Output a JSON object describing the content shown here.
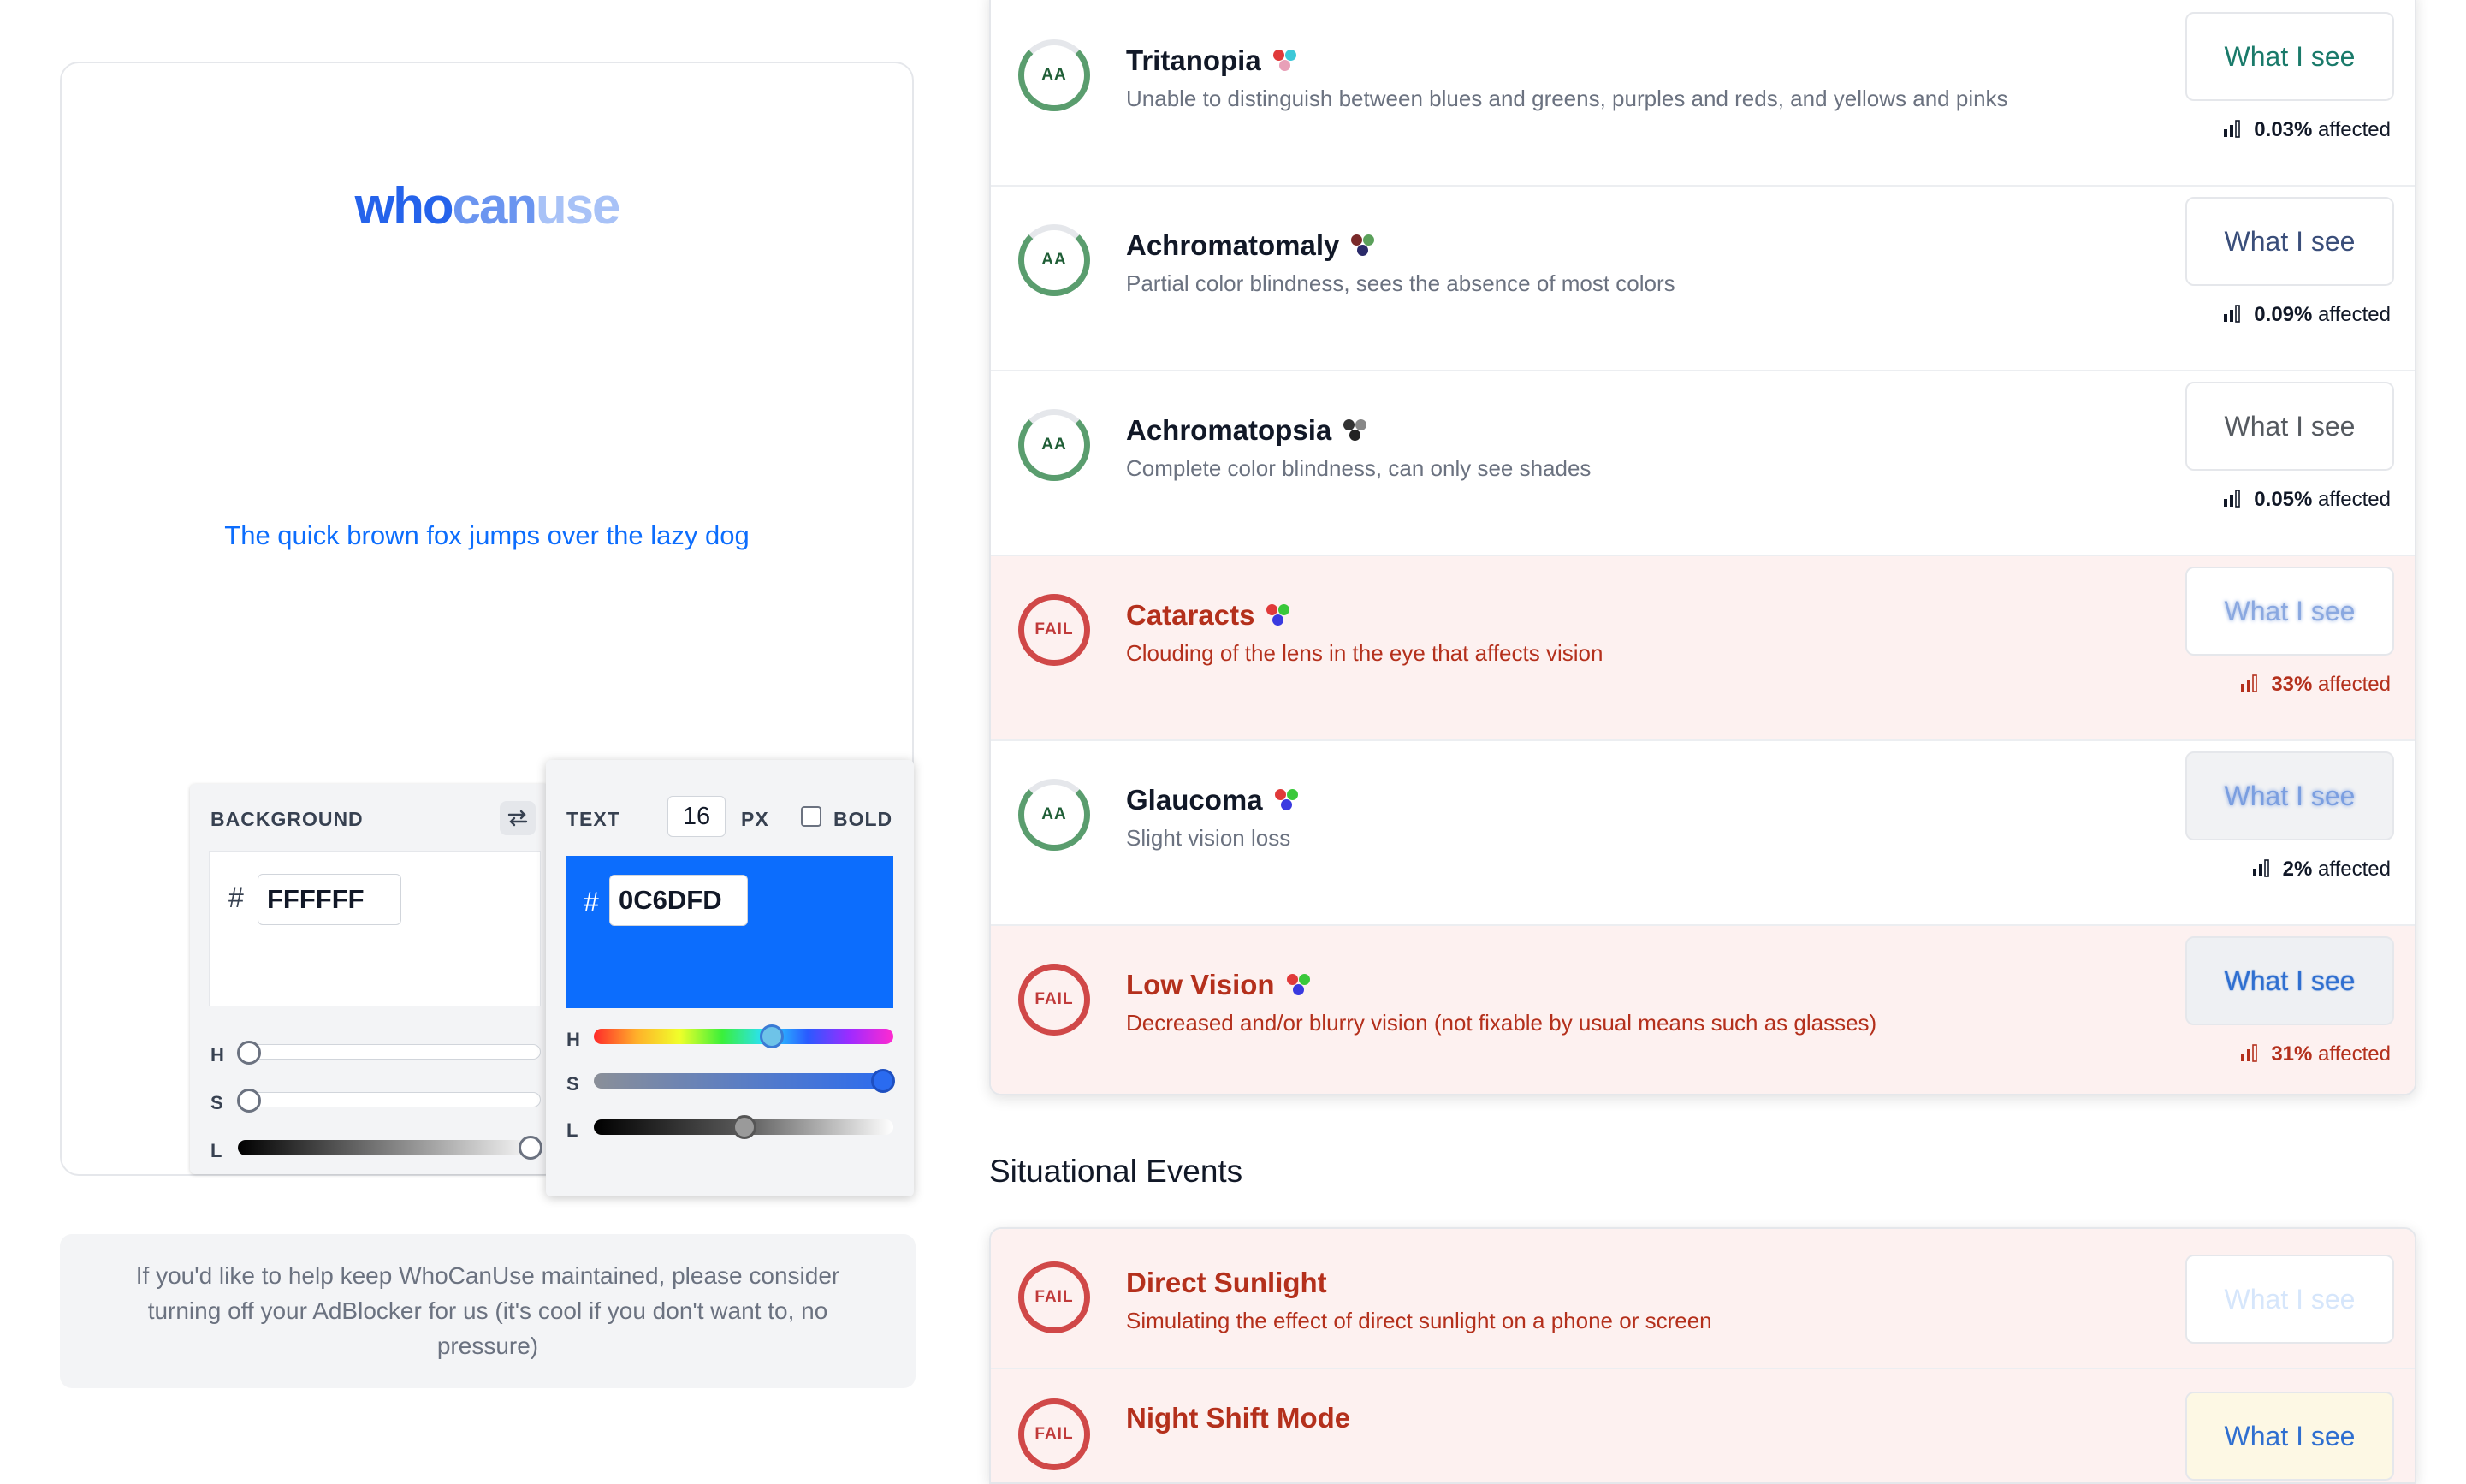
{
  "logo": {
    "part1": "who",
    "part2": "can",
    "part3": "use"
  },
  "preview": {
    "sample_text": "The quick brown fox jumps over the lazy dog"
  },
  "background_panel": {
    "label": "BACKGROUND",
    "hash": "#",
    "hex": "FFFFFF",
    "sliders": {
      "h": "H",
      "s": "S",
      "l": "L"
    },
    "swap_icon": "swap-arrows-icon"
  },
  "text_panel": {
    "label": "TEXT",
    "size": "16",
    "unit": "PX",
    "bold_label": "BOLD",
    "bold_checked": false,
    "hash": "#",
    "hex": "0C6DFD",
    "color": "#0c6dfd",
    "sliders": {
      "h": "H",
      "s": "S",
      "l": "L"
    }
  },
  "ad_notice": "If you'd like to help keep WhoCanUse maintained, please consider turning off your AdBlocker for us (it's cool if you don't want to, no pressure)",
  "conditions": [
    {
      "title": "Tritanopia",
      "desc": "Unable to distinguish between blues and greens, purples and reds, and yellows and pinks",
      "badge": "AA",
      "status": "pass",
      "button": "What I see",
      "affected_value": "0.03%",
      "affected_label": "affected",
      "dots": [
        "#e03a3a",
        "#3cc8d8",
        "#e8a0b8"
      ]
    },
    {
      "title": "Achromatomaly",
      "desc": "Partial color blindness, sees the absence of most colors",
      "badge": "AA",
      "status": "pass",
      "button": "What I see",
      "affected_value": "0.09%",
      "affected_label": "affected",
      "dots": [
        "#7a2a2a",
        "#5aa05a",
        "#2a2a6a"
      ]
    },
    {
      "title": "Achromatopsia",
      "desc": "Complete color blindness, can only see shades",
      "badge": "AA",
      "status": "pass",
      "button": "What I see",
      "affected_value": "0.05%",
      "affected_label": "affected",
      "dots": [
        "#333333",
        "#888888",
        "#222222"
      ]
    },
    {
      "title": "Cataracts",
      "desc": "Clouding of the lens in the eye that affects vision",
      "badge": "FAIL",
      "status": "fail",
      "button": "What I see",
      "affected_value": "33%",
      "affected_label": "affected",
      "dots": [
        "#e03a3a",
        "#3ac83a",
        "#3a3ae0"
      ]
    },
    {
      "title": "Glaucoma",
      "desc": "Slight vision loss",
      "badge": "AA",
      "status": "pass",
      "button": "What I see",
      "affected_value": "2%",
      "affected_label": "affected",
      "dots": [
        "#e03a3a",
        "#3ac83a",
        "#3a3ae0"
      ]
    },
    {
      "title": "Low Vision",
      "desc": "Decreased and/or blurry vision (not fixable by usual means such as glasses)",
      "badge": "FAIL",
      "status": "fail",
      "button": "What I see",
      "affected_value": "31%",
      "affected_label": "affected",
      "dots": [
        "#e03a3a",
        "#3ac83a",
        "#3a3ae0"
      ]
    }
  ],
  "situational": {
    "title": "Situational Events",
    "items": [
      {
        "title": "Direct Sunlight",
        "desc": "Simulating the effect of direct sunlight on a phone or screen",
        "badge": "FAIL",
        "button": "What I see"
      },
      {
        "title": "Night Shift Mode",
        "badge": "FAIL",
        "button": "What I see"
      }
    ]
  },
  "colors": {
    "accent": "#0c6dfd",
    "fail": "#b4301c",
    "pass": "#5a9d6e",
    "fail_bg": "#fdf1f0"
  }
}
